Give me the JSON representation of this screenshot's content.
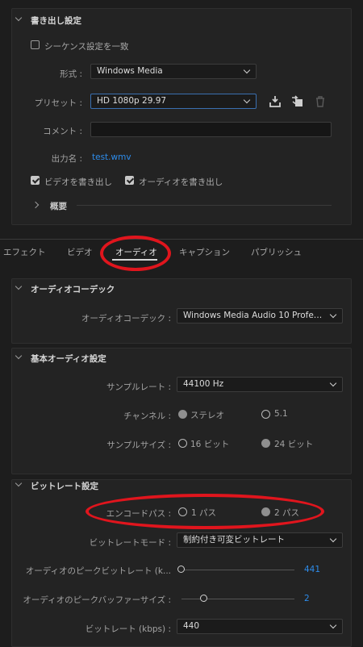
{
  "export": {
    "title": "書き出し設定",
    "match_sequence": "シーケンス設定を一致",
    "format_label": "形式 :",
    "format_value": "Windows Media",
    "preset_label": "プリセット :",
    "preset_value": "HD 1080p 29.97",
    "comment_label": "コメント :",
    "comment_value": "",
    "output_label": "出力名 :",
    "output_value": "test.wmv",
    "export_video": "ビデオを書き出し",
    "export_audio": "オーディオを書き出し",
    "summary": "概要"
  },
  "tabs": [
    {
      "label": "エフェクト"
    },
    {
      "label": "ビデオ"
    },
    {
      "label": "オーディオ"
    },
    {
      "label": "キャプション"
    },
    {
      "label": "パブリッシュ"
    }
  ],
  "codec": {
    "title": "オーディオコーデック",
    "label": "オーディオコーデック :",
    "value": "Windows Media Audio 10 Professi..."
  },
  "basic": {
    "title": "基本オーディオ設定",
    "sample_rate_label": "サンプルレート :",
    "sample_rate_value": "44100 Hz",
    "channel_label": "チャンネル :",
    "channel_stereo": "ステレオ",
    "channel_51": "5.1",
    "sample_size_label": "サンプルサイズ :",
    "sample_size_16": "16 ビット",
    "sample_size_24": "24 ビット"
  },
  "bitrate": {
    "title": "ビットレート設定",
    "encode_pass_label": "エンコードパス :",
    "pass_1": "1 パス",
    "pass_2": "2 パス",
    "mode_label": "ビットレートモード :",
    "mode_value": "制約付き可変ビットレート",
    "peak_bitrate_label": "オーディオのピークビットレート (k...",
    "peak_bitrate_value": "441",
    "peak_buffer_label": "オーディオのピークバッファーサイズ :",
    "peak_buffer_value": "2",
    "bitrate_label": "ビットレート (kbps) :",
    "bitrate_value": "440"
  },
  "colors": {
    "accent_blue": "#2d8ceb",
    "annotation_red": "#e0151d"
  }
}
